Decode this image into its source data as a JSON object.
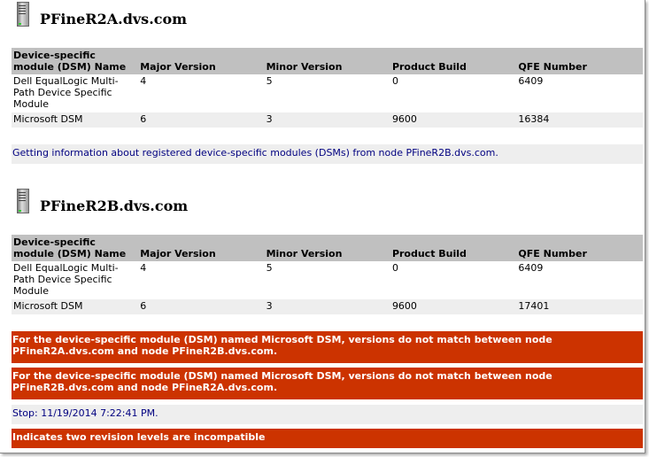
{
  "columns": [
    "Device-specific module (DSM) Name",
    "Major Version",
    "Minor Version",
    "Product Build",
    "QFE Number"
  ],
  "nodes": [
    {
      "name": "PFineR2A.dvs.com",
      "rows": [
        [
          "Dell EqualLogic Multi-Path Device Specific Module",
          "4",
          "5",
          "0",
          "6409"
        ],
        [
          "Microsoft DSM",
          "6",
          "3",
          "9600",
          "16384"
        ]
      ]
    },
    {
      "name": "PFineR2B.dvs.com",
      "rows": [
        [
          "Dell EqualLogic Multi-Path Device Specific Module",
          "4",
          "5",
          "0",
          "6409"
        ],
        [
          "Microsoft DSM",
          "6",
          "3",
          "9600",
          "17401"
        ]
      ]
    }
  ],
  "info_message": "Getting information about registered device-specific modules (DSMs) from node PFineR2B.dvs.com.",
  "errors": [
    "For the device-specific module (DSM) named Microsoft DSM, versions do not match between node PFineR2A.dvs.com and node PFineR2B.dvs.com.",
    "For the device-specific module (DSM) named Microsoft DSM, versions do not match between node PFineR2B.dvs.com and node PFineR2A.dvs.com."
  ],
  "stop_message": "Stop: 11/19/2014 7:22:41 PM.",
  "legend": "Indicates two revision levels are incompatible",
  "colors": {
    "error": "#cc3300",
    "info_text": "#000080",
    "header": "#c0c0c0"
  }
}
